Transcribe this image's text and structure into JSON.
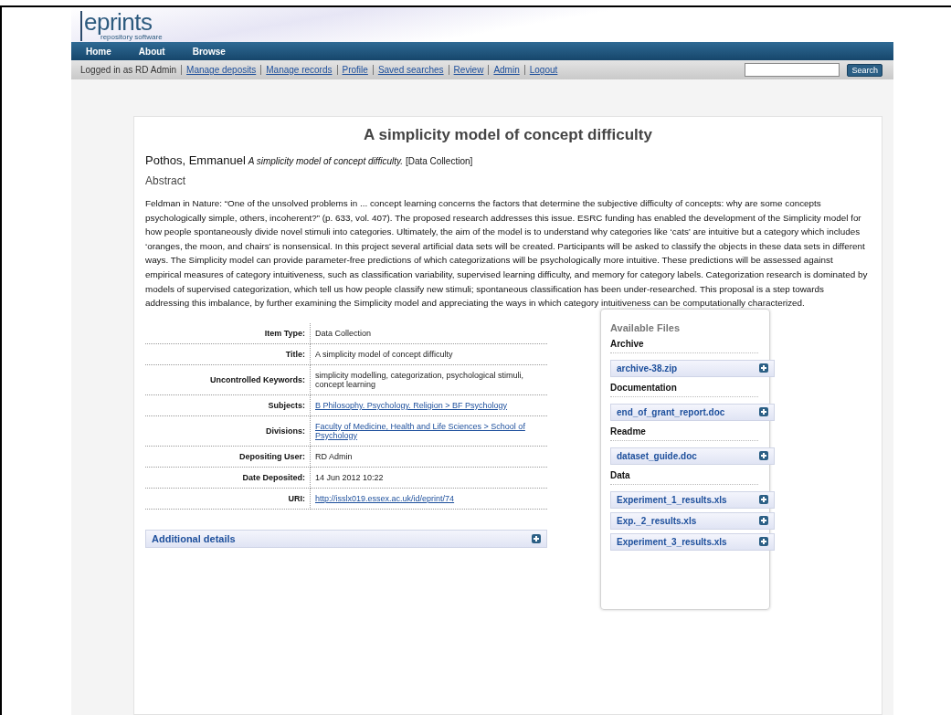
{
  "logo": {
    "name": "eprints",
    "tagline": "repository software"
  },
  "nav": [
    "Home",
    "About",
    "Browse"
  ],
  "user_bar": {
    "logged_in": "Logged in as RD Admin",
    "links": [
      "Manage deposits",
      "Manage records",
      "Profile",
      "Saved searches",
      "Review",
      "Admin",
      "Logout"
    ],
    "search_button": "Search"
  },
  "title": "A simplicity model of concept difficulty",
  "citation": {
    "author": "Pothos, Emmanuel",
    "work": "A simplicity model of concept difficulty.",
    "type": "[Data Collection]"
  },
  "abstract": {
    "heading": "Abstract",
    "text": "Feldman in Nature: “One of the unsolved problems in ... concept learning concerns the factors that determine the subjective difficulty of concepts: why are some concepts psychologically simple, others, incoherent?” (p. 633, vol. 407). The proposed research addresses this issue.  ESRC funding has enabled the development of the Simplicity model for how people spontaneously divide novel stimuli into categories. Ultimately, the aim of the model is to understand why categories like ‘cats’ are intuitive but a category which includes ‘oranges, the moon, and chairs’ is nonsensical. In this project several artificial data sets will be created. Participants will be asked to classify the objects in these data sets in different ways. The Simplicity model can provide parameter-free predictions of which categorizations will be psychologically more intuitive. These predictions will be assessed against empirical measures of category intuitiveness, such as classification variability, supervised learning difficulty, and memory for category labels.  Categorization research is dominated by models of supervised categorization, which tell us how people classify new stimuli; spontaneous classification has been under-researched. This proposal is a step towards addressing this imbalance, by further examining the Simplicity model and appreciating the ways in which category intuitiveness can be computationally characterized."
  },
  "metadata": [
    {
      "label": "Item Type:",
      "value": "Data Collection",
      "kind": "text"
    },
    {
      "label": "Title:",
      "value": "A simplicity model of concept difficulty",
      "kind": "text"
    },
    {
      "label": "Uncontrolled Keywords:",
      "value": "simplicity modelling, categorization, psychological stimuli, concept learning",
      "kind": "text"
    },
    {
      "label": "Subjects:",
      "value": "B Philosophy. Psychology. Religion > BF Psychology",
      "kind": "link"
    },
    {
      "label": "Divisions:",
      "value": "Faculty of Medicine, Health and Life Sciences > School of Psychology",
      "kind": "link"
    },
    {
      "label": "Depositing User:",
      "value": "RD Admin",
      "kind": "text"
    },
    {
      "label": "Date Deposited:",
      "value": "14 Jun 2012 10:22",
      "kind": "text"
    },
    {
      "label": "URI:",
      "value": "http://isslx019.essex.ac.uk/id/eprint/74",
      "kind": "link"
    }
  ],
  "additional_details": {
    "label": "Additional details",
    "expanded": false
  },
  "files": {
    "heading": "Available Files",
    "groups": [
      {
        "name": "Archive",
        "files": [
          {
            "name": "archive-38.zip",
            "expanded": false
          }
        ]
      },
      {
        "name": "Documentation",
        "files": [
          {
            "name": "end_of_grant_report.doc",
            "expanded": false
          }
        ]
      },
      {
        "name": "Readme",
        "files": [
          {
            "name": "dataset_guide.doc",
            "expanded": false
          }
        ]
      },
      {
        "name": "Data",
        "files": [
          {
            "name": "Experiment_1_results.xls",
            "expanded": false
          },
          {
            "name": "Exp._2_results.xls",
            "expanded": false
          },
          {
            "name": "Experiment_3_results.xls",
            "expanded": false
          }
        ]
      }
    ]
  }
}
